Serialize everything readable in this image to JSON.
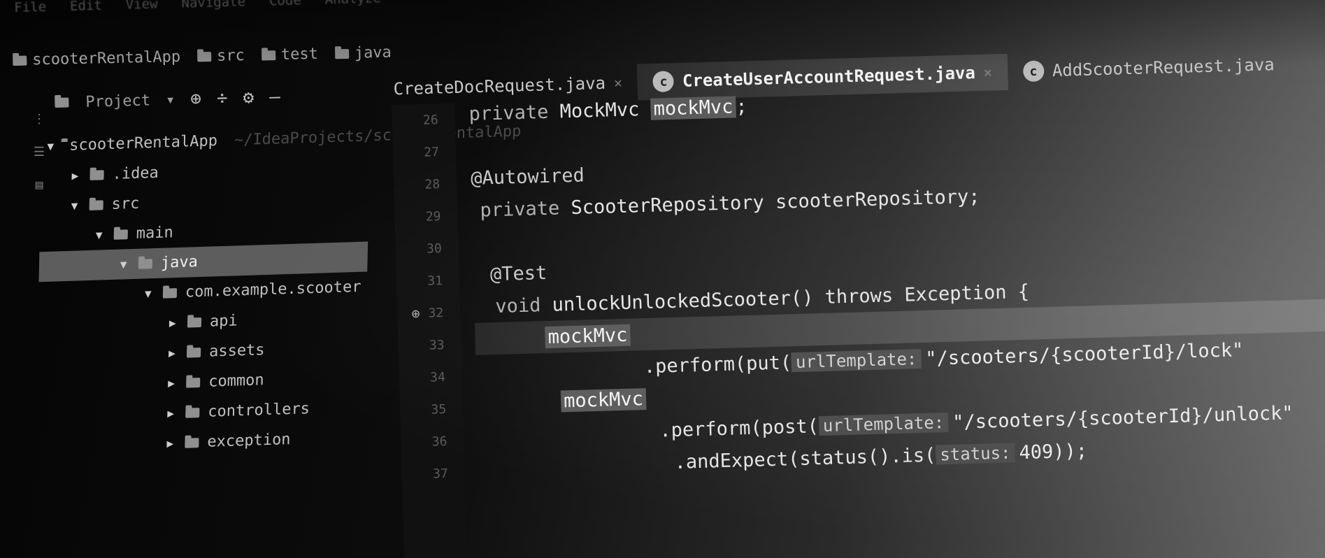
{
  "menubar": [
    "File",
    "Edit",
    "View",
    "Navigate",
    "Code",
    "Analyze"
  ],
  "breadcrumbs": [
    {
      "label": "scooterRentalApp",
      "icon": "module-icon"
    },
    {
      "label": "src",
      "icon": "folder-icon"
    },
    {
      "label": "test",
      "icon": "folder-icon"
    },
    {
      "label": "java",
      "icon": "folder-icon"
    }
  ],
  "toolbar": {
    "project_label": "Project",
    "dropdown_glyph": "▾",
    "sync_glyph": "⊕",
    "collapse_glyph": "÷",
    "settings_glyph": "⚙",
    "hide_glyph": "—"
  },
  "tabs": [
    {
      "label": "CreateDocRequest.java",
      "active": false
    },
    {
      "label": "CreateUserAccountRequest.java",
      "active": true
    },
    {
      "label": "AddScooterRequest.java",
      "active": false
    }
  ],
  "project_tree": [
    {
      "indent": 0,
      "arrow": "▼",
      "icon": "module",
      "label": "scooterRentalApp",
      "hint": "~/IdeaProjects/scooterRentalApp",
      "selected": false
    },
    {
      "indent": 1,
      "arrow": "▶",
      "icon": "folder",
      "label": ".idea",
      "selected": false
    },
    {
      "indent": 1,
      "arrow": "▼",
      "icon": "folder",
      "label": "src",
      "selected": false
    },
    {
      "indent": 2,
      "arrow": "▼",
      "icon": "folder",
      "label": "main",
      "selected": false
    },
    {
      "indent": 3,
      "arrow": "▼",
      "icon": "folder",
      "label": "java",
      "selected": true
    },
    {
      "indent": 4,
      "arrow": "▼",
      "icon": "package",
      "label": "com.example.scooter",
      "selected": false
    },
    {
      "indent": 5,
      "arrow": "▶",
      "icon": "package",
      "label": "api",
      "selected": false
    },
    {
      "indent": 5,
      "arrow": "▶",
      "icon": "package",
      "label": "assets",
      "selected": false
    },
    {
      "indent": 5,
      "arrow": "▶",
      "icon": "package",
      "label": "common",
      "selected": false
    },
    {
      "indent": 5,
      "arrow": "▶",
      "icon": "package",
      "label": "controllers",
      "selected": false
    },
    {
      "indent": 5,
      "arrow": "▶",
      "icon": "package",
      "label": "exception",
      "selected": false
    }
  ],
  "gutter": [
    {
      "n": "26",
      "mark": ""
    },
    {
      "n": "27",
      "mark": ""
    },
    {
      "n": "28",
      "mark": ""
    },
    {
      "n": "29",
      "mark": ""
    },
    {
      "n": "30",
      "mark": ""
    },
    {
      "n": "31",
      "mark": ""
    },
    {
      "n": "32",
      "mark": "⊕"
    },
    {
      "n": "33",
      "mark": ""
    },
    {
      "n": "34",
      "mark": ""
    },
    {
      "n": "35",
      "mark": ""
    },
    {
      "n": "36",
      "mark": ""
    },
    {
      "n": "37",
      "mark": ""
    }
  ],
  "code": {
    "l1": {
      "kw": "private",
      "type": " MockMvc ",
      "var": "mockMvc",
      "end": ";"
    },
    "l3": {
      "ann": "@Autowired"
    },
    "l4": {
      "kw": "private",
      "rest": " ScooterRepository scooterRepository;"
    },
    "l6": {
      "ann": "@Test"
    },
    "l7": {
      "kw": "void",
      "rest": " unlockUnlockedScooter() throws Exception {"
    },
    "l8": {
      "var": "mockMvc"
    },
    "l9": {
      "call": ".perform(put(",
      "param": "urlTemplate:",
      "str": "\"/scooters/{scooterId}/lock\""
    },
    "l10": {
      "var": "mockMvc"
    },
    "l11": {
      "call": ".perform(post(",
      "param": "urlTemplate:",
      "str": "\"/scooters/{scooterId}/unlock\""
    },
    "l12": {
      "call": ".andExpect(status().is(",
      "param": "status:",
      "str": "409));"
    }
  }
}
